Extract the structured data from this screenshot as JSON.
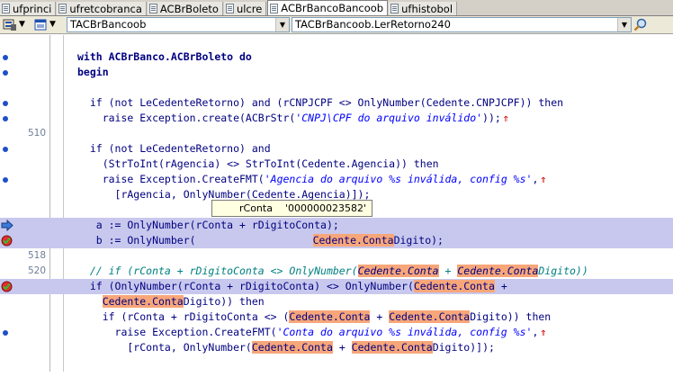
{
  "tabs": [
    {
      "label": "ufprinci",
      "active": false
    },
    {
      "label": "ufretcobranca",
      "active": false
    },
    {
      "label": "ACBrBoleto",
      "active": false
    },
    {
      "label": "ulcre",
      "active": false
    },
    {
      "label": "ACBrBancoBancoob",
      "active": true
    },
    {
      "label": "ufhistobol",
      "active": false
    }
  ],
  "toolbar": {
    "class_combo": "TACBrBancoob",
    "method_combo": "TACBrBancoob.LerRetorno240",
    "icons": [
      "object-inspector-icon",
      "unit-list-icon",
      "find-icon"
    ]
  },
  "tooltip": {
    "name": "rConta",
    "value": "'000000023582'"
  },
  "line_numbers": {
    "l510": "510",
    "l518": "518",
    "l520": "520"
  },
  "code": {
    "with": "with ACBrBanco.ACBrBoleto do",
    "begin": "begin",
    "l1a": "  if (not LeCedenteRetorno) and (rCNPJCPF <> OnlyNumber(Cedente.CNPJCPF)) then",
    "l1b": "    raise Exception.create(ACBrStr(",
    "l1b_str": "'CNPJ\\CPF do arquivo inválido'",
    "l1b_end": "));",
    "l2a": "  if (not LeCedenteRetorno) and",
    "l2b": "    (StrToInt(rAgencia) <> StrToInt(Cedente.Agencia)) then",
    "l2c": "    raise Exception.CreateFMT(",
    "l2c_str": "'Agencia do arquivo %s inválida, config %s'",
    "l2c_end": ",",
    "l2d": "      [rAgencia, OnlyNumber(Cedente.Agencia)]);",
    "a_line": "   a := OnlyNumber(rConta + rDigitoConta);",
    "b_line_pre": "   b := OnlyNumber(",
    "b_line_mark": "Cedente.Conta",
    "b_line_post": "Digito);",
    "comment": "  // if (rConta + rDigitoConta <> OnlyNumber(",
    "cmt_mark1": "Cedente.Conta",
    "cmt_mid": " + ",
    "cmt_mark2": "Cedente.Conta",
    "cmt_end": "Digito))",
    "if2_pre": "  if (OnlyNumber(rConta + rDigitoConta) <> OnlyNumber(",
    "if2_mark": "Cedente.Conta",
    "if2_end": " +",
    "if2b_pre": "    ",
    "if2b_mark": "Cedente.Conta",
    "if2b_end": "Digito)) then",
    "if3_pre": "    if (rConta + rDigitoConta <> (",
    "if3_mark1": "Cedente.Conta",
    "if3_mid": " + ",
    "if3_mark2": "Cedente.Conta",
    "if3_end": "Digito)) then",
    "raise3_pre": "      raise Exception.CreateFMT(",
    "raise3_str": "'Conta do arquivo %s inválida, config %s'",
    "raise3_end": ",",
    "raise3b_pre": "        [rConta, OnlyNumber(",
    "raise3b_mark1": "Cedente.Conta",
    "raise3b_mid": " + ",
    "raise3b_mark2": "Cedente.Conta",
    "raise3b_end": "Digito)]);"
  },
  "colors": {
    "highlight_line": "#c8c8ee",
    "search_match": "#f7a67a",
    "keyword": "#000080",
    "string": "#0000ff",
    "comment": "#008080",
    "breakpoint_dot": "#1d50c8"
  }
}
